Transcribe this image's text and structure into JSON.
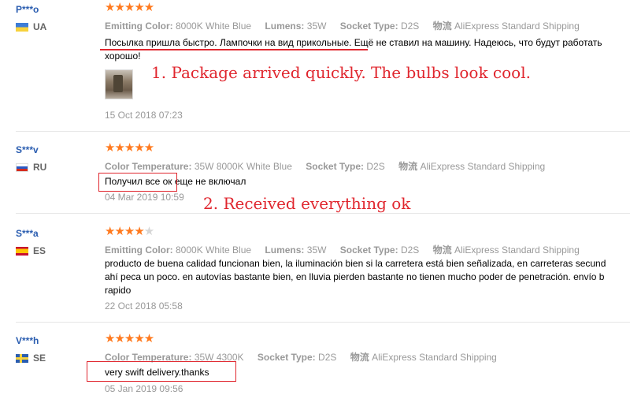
{
  "reviews": [
    {
      "user": "P***o",
      "country": "UA",
      "rating": 5,
      "attrs": [
        {
          "k": "Emitting Color:",
          "v": "8000K White Blue"
        },
        {
          "k": "Lumens:",
          "v": "35W"
        },
        {
          "k": "Socket Type:",
          "v": "D2S"
        },
        {
          "k": "物流",
          "v": "AliExpress Standard Shipping"
        }
      ],
      "text_line1": "Посылка пришла быстро. Лампочки на вид прикольные. Ещё не ставил на машину. Надеюсь, что будут работать",
      "text_line2": "хорошо!",
      "date": "15 Oct 2018 07:23"
    },
    {
      "user": "S***v",
      "country": "RU",
      "rating": 5,
      "attrs": [
        {
          "k": "Color Temperature:",
          "v": "35W 8000K White Blue"
        },
        {
          "k": "Socket Type:",
          "v": "D2S"
        },
        {
          "k": "物流",
          "v": "AliExpress Standard Shipping"
        }
      ],
      "text_line1": "Получил все ок еще не включал",
      "date": "04 Mar 2019 10:59"
    },
    {
      "user": "S***a",
      "country": "ES",
      "rating": 4,
      "attrs": [
        {
          "k": "Emitting Color:",
          "v": "8000K White Blue"
        },
        {
          "k": "Lumens:",
          "v": "35W"
        },
        {
          "k": "Socket Type:",
          "v": "D2S"
        },
        {
          "k": "物流",
          "v": "AliExpress Standard Shipping"
        }
      ],
      "text_line1": "producto de buena calidad funcionan bien, la iluminación bien si la carretera está bien señalizada, en carreteras secund",
      "text_line2": "ahí peca un poco. en autovías bastante bien, en lluvia pierden bastante no tienen mucho poder de penetración. envío b",
      "text_line3": "rapido",
      "date": "22 Oct 2018 05:58"
    },
    {
      "user": "V***h",
      "country": "SE",
      "rating": 5,
      "attrs": [
        {
          "k": "Color Temperature:",
          "v": "35W 4300K"
        },
        {
          "k": "Socket Type:",
          "v": "D2S"
        },
        {
          "k": "物流",
          "v": "AliExpress Standard Shipping"
        }
      ],
      "text_line1": "very swift delivery.thanks",
      "date": "05 Jan 2019 09:56"
    }
  ],
  "annotations": {
    "a1": "1. Package arrived quickly. The bulbs look cool.",
    "a2": "2. Received everything ok"
  },
  "colors": {
    "star": "#ff7a1f",
    "annotation": "#e0262e",
    "username": "#2a5db0"
  }
}
